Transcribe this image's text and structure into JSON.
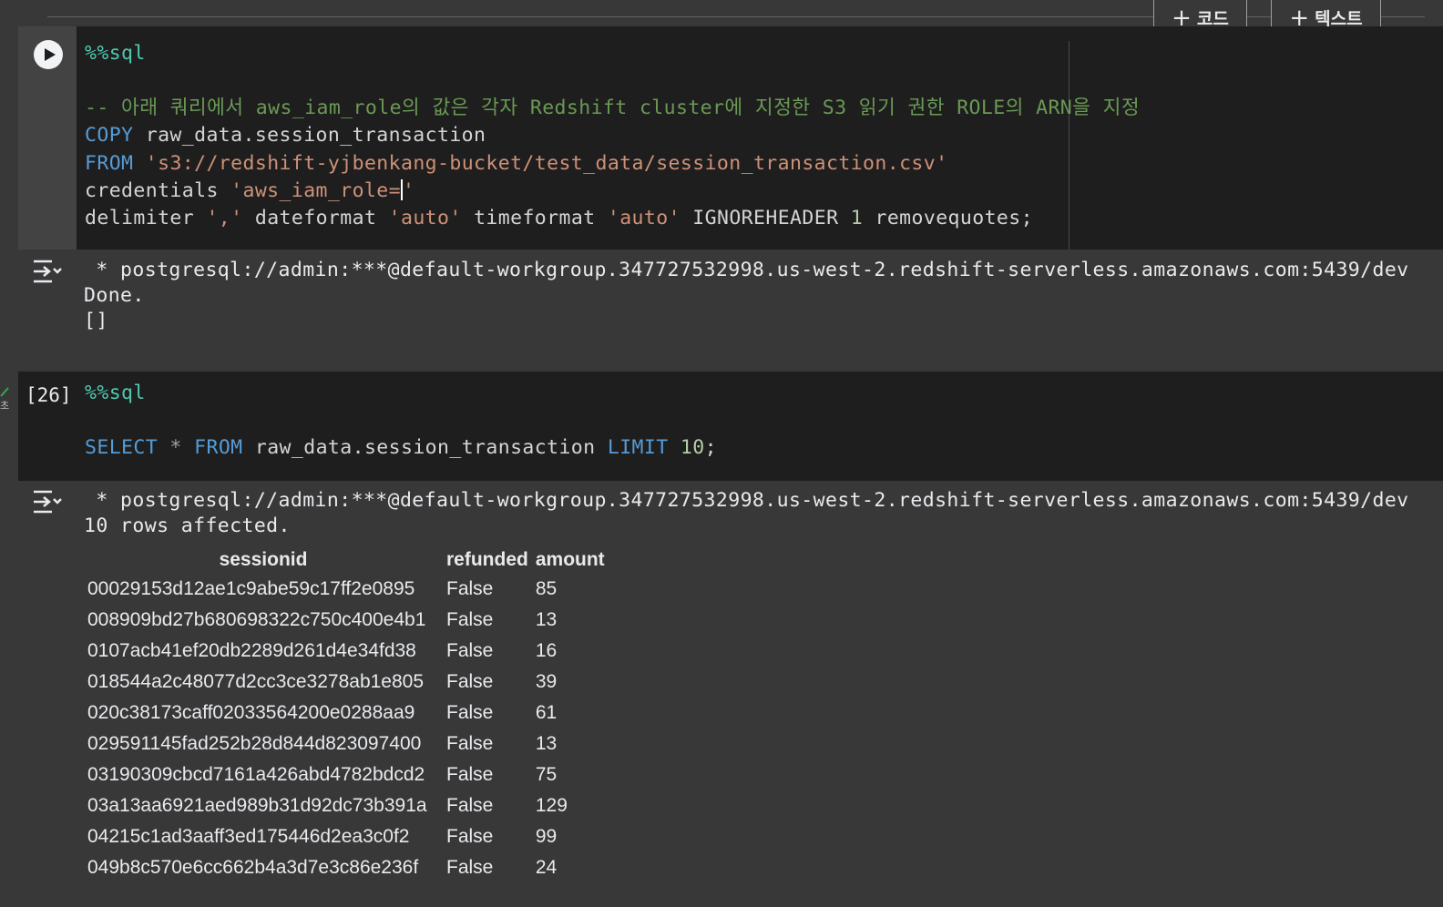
{
  "toolbar": {
    "add_code_label": "코드",
    "add_text_label": "텍스트"
  },
  "cell1": {
    "magic": "%%sql",
    "comment": "-- 아래 쿼리에서 aws_iam_role의 값은 각자 Redshift cluster에 지정한 S3 읽기 권한 ROLE의 ARN을 지정",
    "kw_copy": "COPY",
    "copy_target": " raw_data.session_transaction",
    "kw_from": "FROM",
    "from_path": "'s3://redshift-yjbenkang-bucket/test_data/session_transaction.csv'",
    "cred_label": "credentials ",
    "cred_value": "'aws_iam_role=",
    "cred_close": "'",
    "delim_label": "delimiter ",
    "delim_value": "','",
    "datefmt_label": " dateformat ",
    "datefmt_value": "'auto'",
    "timefmt_label": " timeformat ",
    "timefmt_value": "'auto'",
    "ignore_label": " IGNOREHEADER ",
    "ignore_value": "1",
    "remove_label": " removequotes;"
  },
  "output1": {
    "connection": " * postgresql://admin:***@default-workgroup.347727532998.us-west-2.redshift-serverless.amazonaws.com:5439/dev",
    "status": "Done.",
    "result": "[]"
  },
  "cell2": {
    "execution_count": "[26]",
    "status_char": "초",
    "magic": "%%sql",
    "kw_select": "SELECT",
    "star": " * ",
    "kw_from": "FROM",
    "table": " raw_data.session_transaction ",
    "kw_limit": "LIMIT",
    "limit_value": " 10",
    "semicolon": ";"
  },
  "output2": {
    "connection": " * postgresql://admin:***@default-workgroup.347727532998.us-west-2.redshift-serverless.amazonaws.com:5439/dev",
    "status": "10 rows affected.",
    "columns": [
      "sessionid",
      "refunded",
      "amount"
    ],
    "rows": [
      [
        "00029153d12ae1c9abe59c17ff2e0895",
        "False",
        "85"
      ],
      [
        "008909bd27b680698322c750c400e4b1",
        "False",
        "13"
      ],
      [
        "0107acb41ef20db2289d261d4e34fd38",
        "False",
        "16"
      ],
      [
        "018544a2c48077d2cc3ce3278ab1e805",
        "False",
        "39"
      ],
      [
        "020c38173caff02033564200e0288aa9",
        "False",
        "61"
      ],
      [
        "029591145fad252b28d844d823097400",
        "False",
        "13"
      ],
      [
        "03190309cbcd7161a426abd4782bdcd2",
        "False",
        "75"
      ],
      [
        "03a13aa6921aed989b31d92dc73b391a",
        "False",
        "129"
      ],
      [
        "04215c1ad3aaff3ed175446d2ea3c0f2",
        "False",
        "99"
      ],
      [
        "049b8c570e6cc662b4a3d7e3c86e236f",
        "False",
        "24"
      ]
    ]
  }
}
